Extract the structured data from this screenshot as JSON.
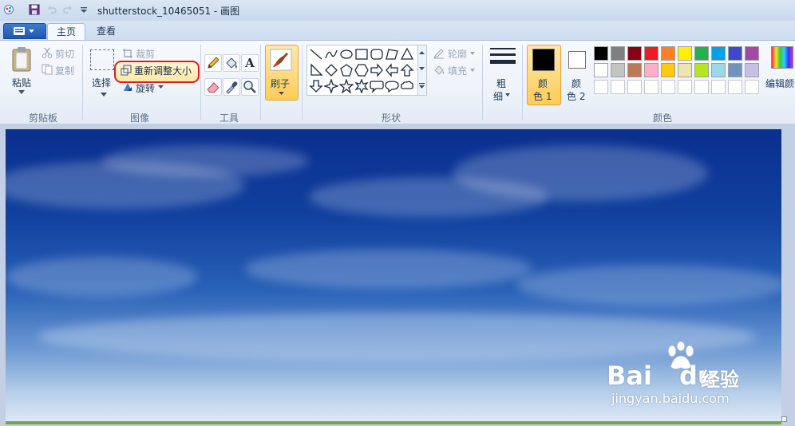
{
  "window": {
    "title": "shutterstock_10465051 - 画图"
  },
  "tabs": {
    "home": "主页",
    "view": "查看"
  },
  "clipboard": {
    "paste": "粘贴",
    "cut": "剪切",
    "copy": "复制",
    "group_label": "剪贴板"
  },
  "image": {
    "select": "选择",
    "crop": "裁剪",
    "resize": "重新调整大小",
    "rotate": "旋转",
    "group_label": "图像"
  },
  "tools": {
    "group_label": "工具",
    "text_glyph": "A"
  },
  "brushes": {
    "label": "刷子"
  },
  "shapes": {
    "outline": "轮廓",
    "fill": "填充",
    "group_label": "形状"
  },
  "size": {
    "label_line1": "粗",
    "label_line2": "细"
  },
  "colors": {
    "color1_line1": "颜",
    "color1_line2": "色 1",
    "color2_line1": "颜",
    "color2_line2": "色 2",
    "group_label": "颜色",
    "edit": "编辑颜色",
    "color1_value": "#000000",
    "color2_value": "#ffffff",
    "row1": [
      "#000000",
      "#7f7f7f",
      "#880015",
      "#ed1c24",
      "#ff7f27",
      "#fff200",
      "#22b14c",
      "#00a2e8",
      "#3f48cc",
      "#a349a4"
    ],
    "row2": [
      "#ffffff",
      "#c3c3c3",
      "#b97a57",
      "#ffaec9",
      "#ffc90e",
      "#efe4b0",
      "#b5e61d",
      "#99d9ea",
      "#7092be",
      "#c8bfe7"
    ],
    "row3": [
      "#ffffff",
      "#ffffff",
      "#ffffff",
      "#ffffff",
      "#ffffff",
      "#ffffff",
      "#ffffff",
      "#ffffff",
      "#ffffff",
      "#ffffff"
    ],
    "highlight": "#d61f26"
  },
  "watermark": {
    "brand": "Bai",
    "brand2": "du",
    "cn": "经验",
    "url": "jingyan.baidu.com"
  }
}
